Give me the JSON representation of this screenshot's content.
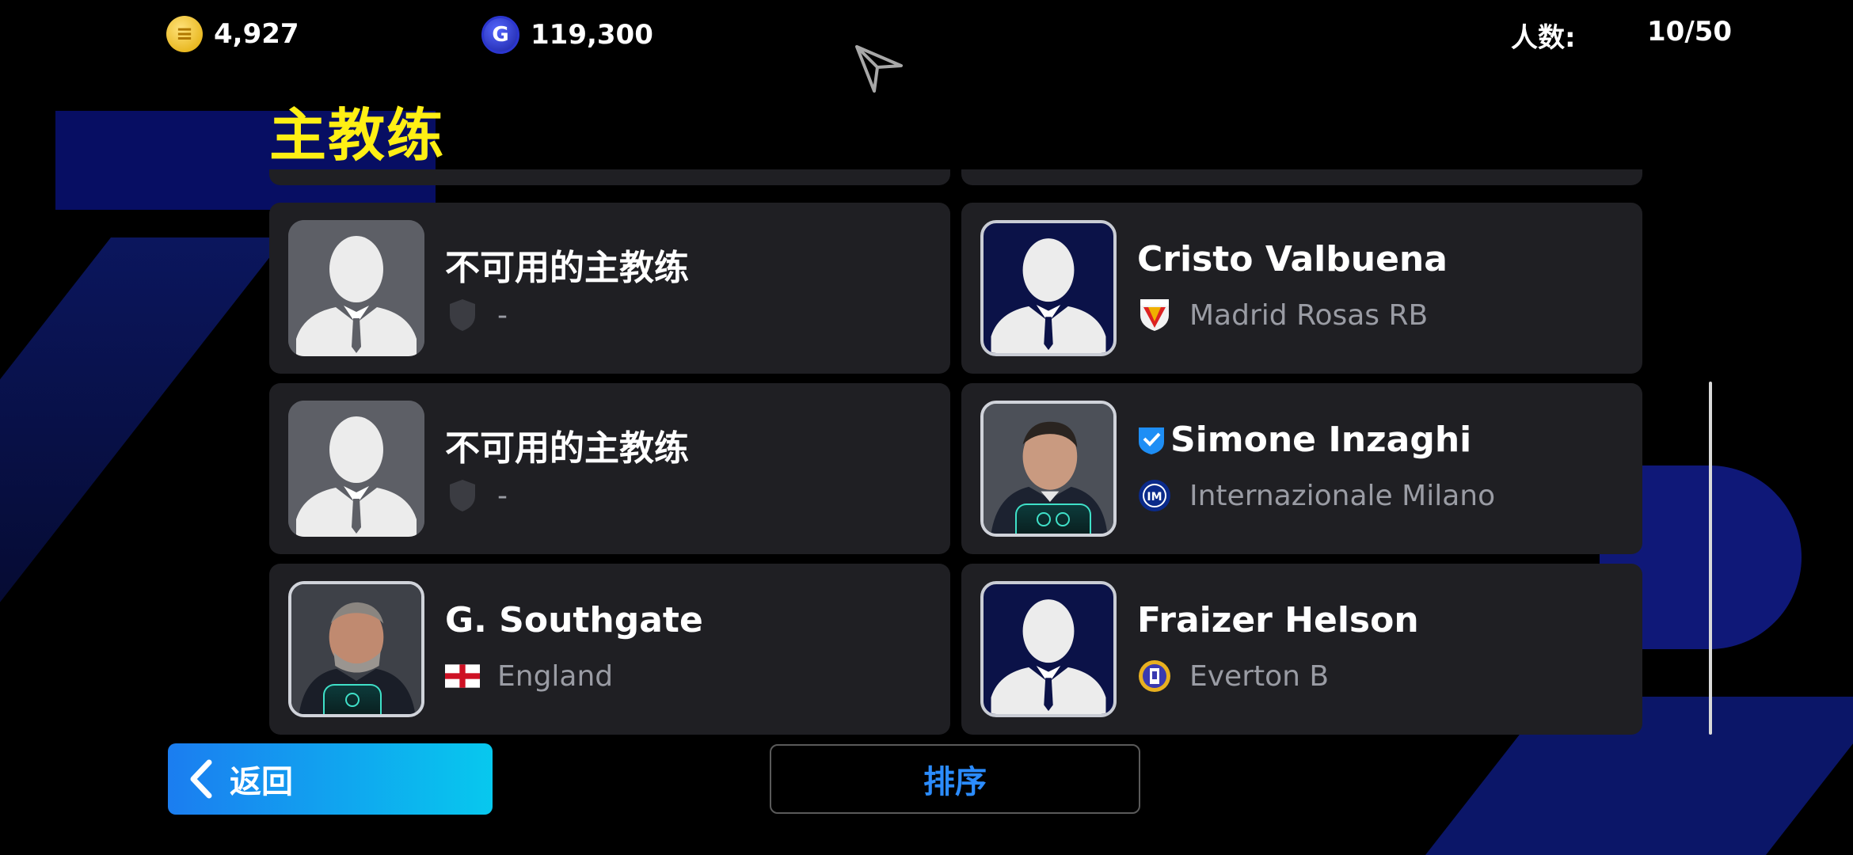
{
  "currency": {
    "gold_coins": "4,927",
    "gp": "119,300"
  },
  "squad_count": {
    "label": "人数:",
    "value": "10/50"
  },
  "page_title": "主教练",
  "coaches": [
    {
      "name": "",
      "club": ""
    },
    {
      "name": "",
      "club": ""
    },
    {
      "name": "不可用的主教练",
      "club": "-"
    },
    {
      "name": "Cristo Valbuena",
      "club": "Madrid Rosas RB"
    },
    {
      "name": "不可用的主教练",
      "club": "-"
    },
    {
      "name": "Simone Inzaghi",
      "club": "Internazionale Milano"
    },
    {
      "name": "G. Southgate",
      "club": "England"
    },
    {
      "name": "Fraizer Helson",
      "club": "Everton B"
    }
  ],
  "buttons": {
    "back": "返回",
    "sort": "排序"
  },
  "colors": {
    "title": "#ffef14",
    "accent_blue": "#2b8cff",
    "card_bg": "#1f1f23",
    "badge_teal": "#3fe0c8"
  }
}
